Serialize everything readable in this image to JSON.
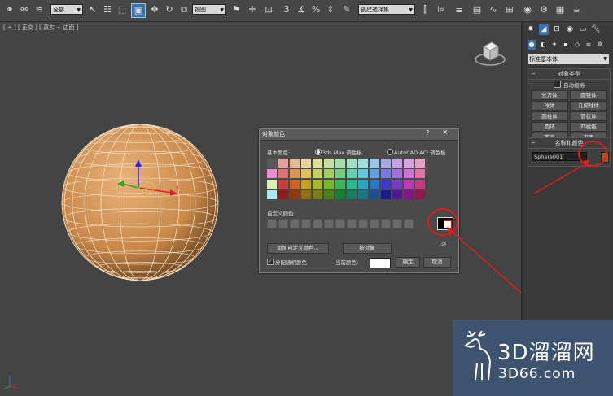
{
  "toolbar": {
    "selection_filter": "全部",
    "ref_coord": "视图",
    "named_selection": "创建选择集",
    "icons": [
      "link-icon",
      "unlink-icon",
      "bind-icon",
      "select-icon",
      "select-by-name-icon",
      "rect-region-icon",
      "window-crossing-icon",
      "move-icon",
      "rotate-icon",
      "scale-icon",
      "pivot-icon",
      "select-manip-icon",
      "snap-icon",
      "angle-snap-icon",
      "percent-snap-icon",
      "spinner-snap-icon",
      "mirror-icon",
      "align-icon",
      "layer-icon",
      "graphite-icon",
      "curve-editor-icon",
      "schematic-icon",
      "material-editor-icon",
      "render-setup-icon",
      "render-frame-icon",
      "render-icon"
    ]
  },
  "viewport": {
    "label": "[ + ] [ 正交 ] [ 真实 + 边面 ]",
    "gizmo_x": "x"
  },
  "dialog": {
    "title": "对象颜色",
    "help": "?",
    "close": "×",
    "basic_colors_label": "基本颜色:",
    "radio_max": "3ds Max 调色板",
    "radio_aci": "AutoCAD ACI 调色板",
    "palette": [
      "#5a5a5a",
      "#e6a0a0",
      "#e6b894",
      "#e6d49a",
      "#dde09a",
      "#c4e09a",
      "#a4e0a8",
      "#9ae0c4",
      "#9ae0dd",
      "#9ac6e6",
      "#a8a8e6",
      "#c4a0e6",
      "#dda0e0",
      "#e6a0c4",
      "#ea8ecf",
      "#e07070",
      "#e09050",
      "#e0c060",
      "#c8d060",
      "#a0d060",
      "#70d080",
      "#60d0b0",
      "#60c8d8",
      "#60a0e0",
      "#7878e0",
      "#a070e0",
      "#d070d8",
      "#e070a8",
      "#d8f0b0",
      "#c83c3c",
      "#c86420",
      "#c8a020",
      "#a8b828",
      "#78b828",
      "#38b850",
      "#28b890",
      "#28a8c0",
      "#2878c8",
      "#3c3cc8",
      "#7838c8",
      "#b838c0",
      "#c83880",
      "#a8e8f0",
      "#901c1c",
      "#903c10",
      "#907010",
      "#788018",
      "#508018",
      "#188030",
      "#188060",
      "#187888",
      "#185090",
      "#1c1c90",
      "#501890",
      "#801888",
      "#901850"
    ],
    "custom_colors_label": "自定义颜色:",
    "custom_count": 13,
    "add_custom_button": "添加自定义颜色...",
    "select_by_color_button": "按对象",
    "assign_random_label": "分配随机颜色",
    "current_color_label": "当前颜色:",
    "ok_button": "确定",
    "cancel_button": "取消"
  },
  "panel": {
    "dropdown": "标准基本体",
    "object_type_title": "对象类型",
    "autogrid_label": "自动栅格",
    "buttons": [
      "长方体",
      "圆锥体",
      "球体",
      "几何球体",
      "圆柱体",
      "管状体",
      "圆环",
      "四棱锥",
      "茶壶",
      "平面"
    ],
    "name_color_title": "名称和颜色",
    "object_name": "Sphere001",
    "object_color": "#a65a1a"
  },
  "watermark": {
    "big": "3D溜溜网",
    "small": "3D66.com"
  },
  "colors": {
    "annotation": "#e21b1b",
    "sphere": "#d99a55"
  }
}
